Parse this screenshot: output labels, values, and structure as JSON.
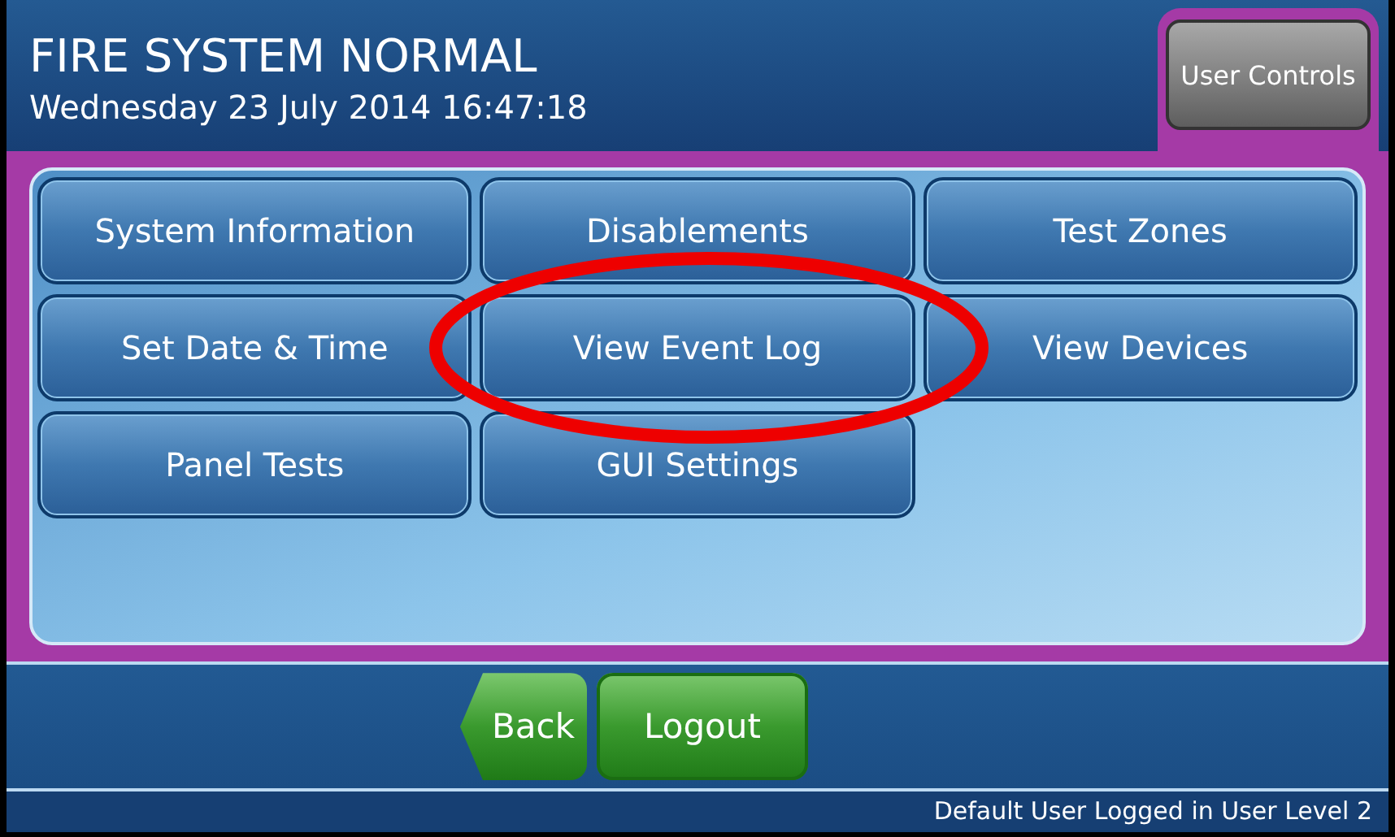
{
  "header": {
    "title": "FIRE SYSTEM NORMAL",
    "datetime": "Wednesday 23 July 2014 16:47:18",
    "tab": {
      "label": "User Controls",
      "selected": true
    }
  },
  "menu": [
    {
      "label": "System Information"
    },
    {
      "label": "Disablements"
    },
    {
      "label": "Test Zones"
    },
    {
      "label": "Set Date & Time"
    },
    {
      "label": "View Event Log"
    },
    {
      "label": "View Devices"
    },
    {
      "label": "Panel Tests"
    },
    {
      "label": "GUI Settings"
    }
  ],
  "annotation": {
    "kind": "ellipse"
  },
  "nav": [
    {
      "label": "Back",
      "kind": "back"
    },
    {
      "label": "Logout",
      "kind": "plain"
    }
  ],
  "status_bar": "Default User Logged in User Level 2"
}
